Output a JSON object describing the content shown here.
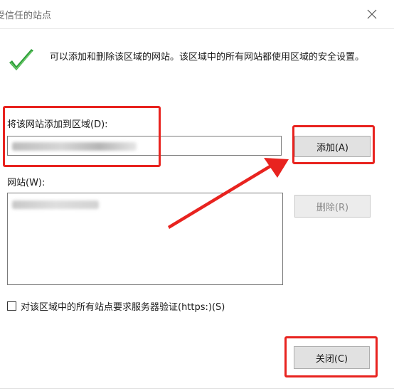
{
  "window": {
    "title": "受信任的站点"
  },
  "info": {
    "text": "可以添加和删除该区域的网站。该区域中的所有网站都使用区域的安全设置。"
  },
  "add_site": {
    "label": "将该网站添加到区域(D):",
    "button_label": "添加(A)"
  },
  "sites": {
    "label": "网站(W):",
    "remove_button_label": "删除(R)"
  },
  "https_option": {
    "label": "对该区域中的所有站点要求服务器验证(https:)(S)",
    "checked": false
  },
  "footer": {
    "close_label": "关闭(C)"
  },
  "colors": {
    "highlight": "#e8231f",
    "check": "#2e9e3a"
  },
  "icons": {
    "close": "close-icon",
    "check": "check-icon"
  }
}
